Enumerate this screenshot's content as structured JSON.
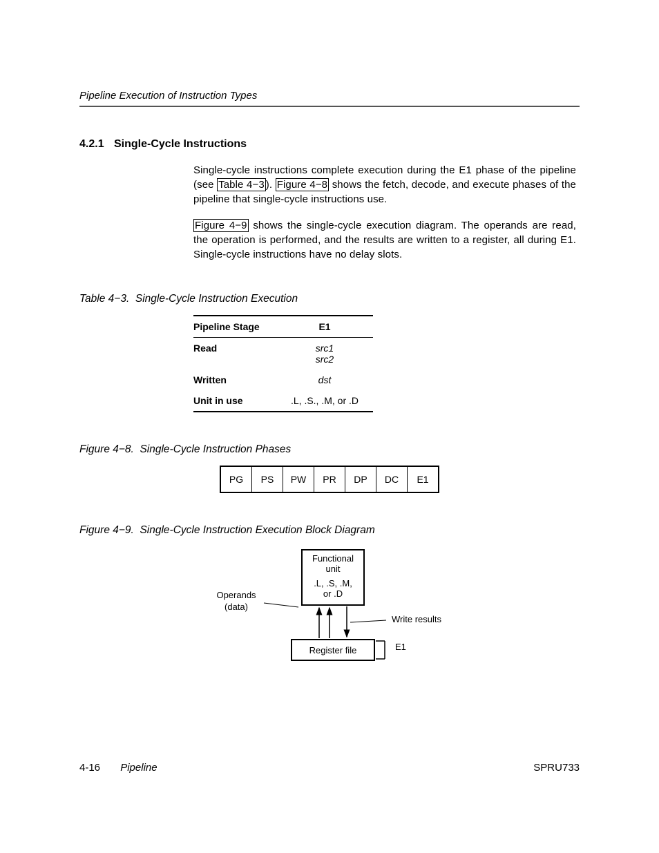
{
  "running_head": "Pipeline Execution of Instruction Types",
  "section": {
    "num": "4.2.1",
    "title": "Single-Cycle Instructions"
  },
  "para1_a": "Single-cycle instructions complete execution during the E1 phase of the pipeline (see ",
  "para1_ref1": "Table 4−3",
  "para1_b": "). ",
  "para1_ref2": "Figure 4−8",
  "para1_c": " shows the fetch, decode, and execute phases of the pipeline that single-cycle instructions use.",
  "para2_ref": "Figure 4−9",
  "para2_rest": " shows the single-cycle execution diagram. The operands are read, the operation is performed, and the results are written to a register, all during E1. Single-cycle instructions have no delay slots.",
  "table43": {
    "caption_num": "Table 4−3.",
    "caption_title": "Single-Cycle Instruction Execution",
    "header": {
      "c1": "Pipeline Stage",
      "c2": "E1"
    },
    "rows": [
      {
        "c1": "Read",
        "c2a": "src1",
        "c2b": "src2",
        "ital": true
      },
      {
        "c1": "Written",
        "c2a": "dst",
        "ital": true
      },
      {
        "c1": "Unit in use",
        "c2a": ".L, .S., .M, or .D"
      }
    ]
  },
  "figure48": {
    "caption_num": "Figure 4−8.",
    "caption_title": "Single-Cycle Instruction Phases",
    "cells": [
      "PG",
      "PS",
      "PW",
      "PR",
      "DP",
      "DC",
      "E1"
    ]
  },
  "figure49": {
    "caption_num": "Figure 4−9.",
    "caption_title": "Single-Cycle Instruction Execution Block Diagram",
    "func_unit_l1": "Functional",
    "func_unit_l2": "unit",
    "func_unit_l3": ".L, .S, .M,",
    "func_unit_l4": "or .D",
    "reg_file": "Register file",
    "operands_l1": "Operands",
    "operands_l2": "(data)",
    "write_results": "Write results",
    "e1": "E1"
  },
  "footer": {
    "left": "4-16",
    "center": "Pipeline",
    "right": "SPRU733"
  }
}
